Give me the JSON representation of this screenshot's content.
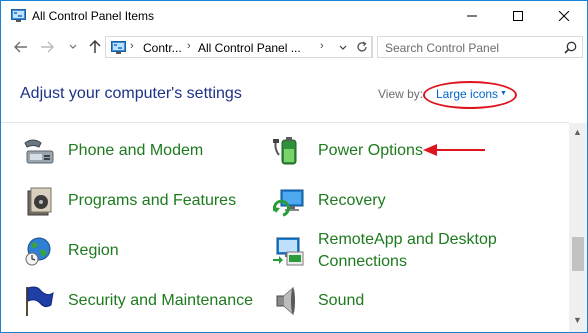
{
  "window": {
    "title": "All Control Panel Items",
    "accent_color": "#1883d7"
  },
  "navbar": {
    "breadcrumb": [
      "Contr...",
      "All Control Panel ..."
    ],
    "search_placeholder": "Search Control Panel"
  },
  "header": {
    "heading": "Adjust your computer's settings",
    "viewby_label": "View by:",
    "viewby_value": "Large icons",
    "link_color": "#0066cc"
  },
  "items": [
    {
      "label": "Phone and Modem",
      "icon": "phone-modem-icon"
    },
    {
      "label": "Power Options",
      "icon": "power-options-icon"
    },
    {
      "label": "Programs and Features",
      "icon": "programs-features-icon"
    },
    {
      "label": "Recovery",
      "icon": "recovery-icon"
    },
    {
      "label": "Region",
      "icon": "region-icon"
    },
    {
      "label": "RemoteApp and Desktop",
      "label2": "Connections",
      "icon": "remoteapp-icon"
    },
    {
      "label": "Security and Maintenance",
      "icon": "security-maintenance-icon"
    },
    {
      "label": "Sound",
      "icon": "sound-icon"
    }
  ],
  "item_color": "#1e7a1e",
  "annotation_color": "#e0141e"
}
